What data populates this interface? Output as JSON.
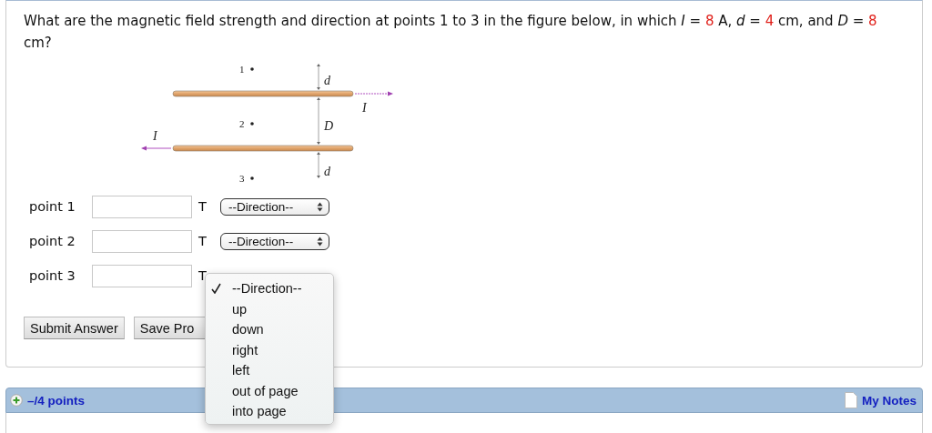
{
  "question": [
    {
      "kind": "plain",
      "text": "What are the magnetic field strength and direction at points 1 to 3 in the figure below, in which *I* = "
    },
    {
      "kind": "value",
      "text": "8"
    },
    {
      "kind": "plain",
      "text": " A, *d* = "
    },
    {
      "kind": "value",
      "text": "4"
    },
    {
      "kind": "plain",
      "text": " cm, and *D* = "
    },
    {
      "kind": "value",
      "text": "8"
    },
    {
      "kind": "plain",
      "text": " cm?"
    }
  ],
  "figure": {
    "point_labels": [
      "1",
      "2",
      "3"
    ],
    "gap_labels": [
      "d",
      "D",
      "d"
    ],
    "current_labels": [
      "I",
      "I"
    ]
  },
  "answers": [
    {
      "label": "point 1",
      "unit": "T",
      "select": "--Direction--"
    },
    {
      "label": "point 2",
      "unit": "T",
      "select": "--Direction--"
    },
    {
      "label": "point 3",
      "unit": "T"
    }
  ],
  "dropdown": {
    "options": [
      {
        "label": "--Direction--",
        "selected": true
      },
      {
        "label": "up",
        "selected": false
      },
      {
        "label": "down",
        "selected": false
      },
      {
        "label": "right",
        "selected": false
      },
      {
        "label": "left",
        "selected": false
      },
      {
        "label": "out of page",
        "selected": false
      },
      {
        "label": "into page",
        "selected": false
      }
    ]
  },
  "buttons": [
    "Submit Answer",
    "Save Pro"
  ],
  "points_bar": {
    "points": "–/4 points",
    "notes": "My Notes"
  }
}
